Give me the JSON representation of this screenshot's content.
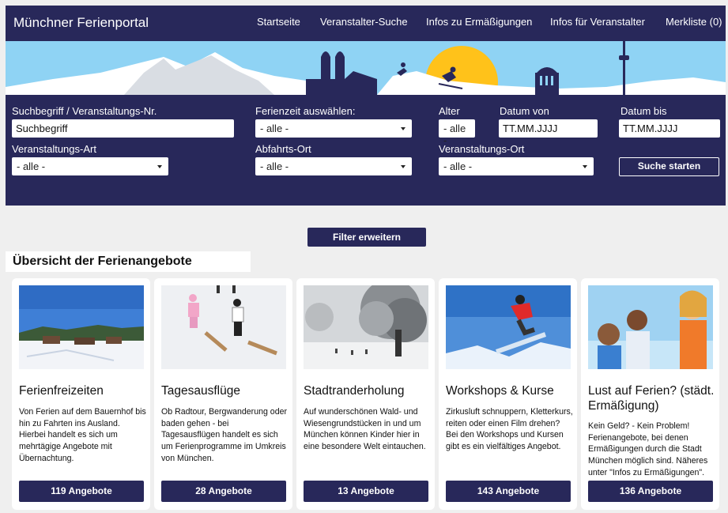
{
  "header": {
    "brand": "Münchner Ferienportal",
    "nav": [
      "Startseite",
      "Veranstalter-Suche",
      "Infos zu Ermäßigungen",
      "Infos für Veranstalter",
      "Merkliste (0)"
    ]
  },
  "search": {
    "keyword_label": "Suchbegriff / Veranstaltungs-Nr.",
    "keyword_value": "Suchbegriff",
    "ferienzeit_label": "Ferienzeit auswählen:",
    "ferienzeit_value": "- alle -",
    "alter_label": "Alter",
    "alter_value": "- alle -",
    "datum_von_label": "Datum von",
    "datum_von_value": "TT.MM.JJJJ",
    "datum_bis_label": "Datum bis",
    "datum_bis_value": "TT.MM.JJJJ",
    "art_label": "Veranstaltungs-Art",
    "art_value": "- alle -",
    "abfahrt_label": "Abfahrts-Ort",
    "abfahrt_value": "- alle -",
    "ort_label": "Veranstaltungs-Ort",
    "ort_value": "- alle -",
    "submit_label": "Suche starten"
  },
  "filter_label": "Filter erweitern",
  "section_title": "Übersicht der Ferienangebote",
  "cards": [
    {
      "title": "Ferienfreizeiten",
      "description": "Von Ferien auf dem Bauernhof bis hin zu Fahrten ins Ausland. Hierbei handelt es sich um mehrtägige Angebote mit Übernachtung.",
      "button": "119 Angebote"
    },
    {
      "title": "Tagesausflüge",
      "description": "Ob Radtour, Bergwanderung oder baden gehen - bei Tagesausflügen handelt es sich um Ferienprogramme im Umkreis von München.",
      "button": "28 Angebote"
    },
    {
      "title": "Stadtranderholung",
      "description": "Auf wunderschönen Wald- und Wiesengrundstücken in und um München können Kinder hier in eine besondere Welt eintauchen.",
      "button": "13 Angebote"
    },
    {
      "title": "Workshops & Kurse",
      "description": "Zirkusluft schnuppern, Kletterkurs, reiten oder einen Film drehen? Bei den Workshops und Kursen gibt es ein vielfältiges Angebot.",
      "button": "143 Angebote"
    },
    {
      "title": "Lust auf Ferien? (städt. Ermäßigung)",
      "description": "Kein Geld? - Kein Problem! Ferienangebote, bei denen Ermäßigungen durch die Stadt München möglich sind. Näheres unter \"Infos zu Ermäßigungen\".",
      "button": "136 Angebote"
    }
  ],
  "colors": {
    "primary": "#28285a",
    "sky": "#8fd3f4",
    "sun": "#ffc21a",
    "background": "#efefef"
  }
}
